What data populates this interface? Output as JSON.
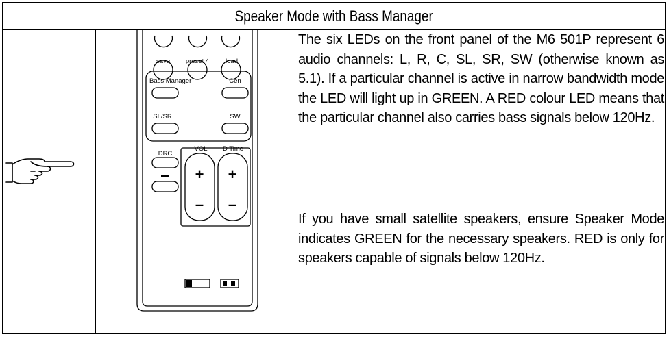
{
  "table": {
    "title": "Speaker Mode with Bass Manager",
    "paragraph_1": "The six LEDs on the front panel of the M6 501P represent 6 audio channels: L, R, C, SL, SR, SW (otherwise known as 5.1). If a particular channel is active in narrow bandwidth mode the LED will light up in GREEN. A RED colour LED means that the particular channel also carries bass signals below 120Hz.",
    "paragraph_2": "If you have small satellite speakers, ensure Speaker Mode indicates GREEN for the necessary speakers. RED is only for speakers capable of signals below 120Hz."
  },
  "icons": {
    "left": "pointing-hand-icon",
    "remote": "remote-control-illustration"
  },
  "remote": {
    "btn_save": "save",
    "btn_preset4": "preset 4",
    "btn_load": "load",
    "btn_bass_manager": "Bass Manager",
    "btn_cen": "Cen",
    "btn_slsr": "SL/SR",
    "btn_sw": "SW",
    "btn_drc": "DRC",
    "vol_label": "VOL",
    "dtime_label": "D Time",
    "plus": "+",
    "minus": "–"
  }
}
